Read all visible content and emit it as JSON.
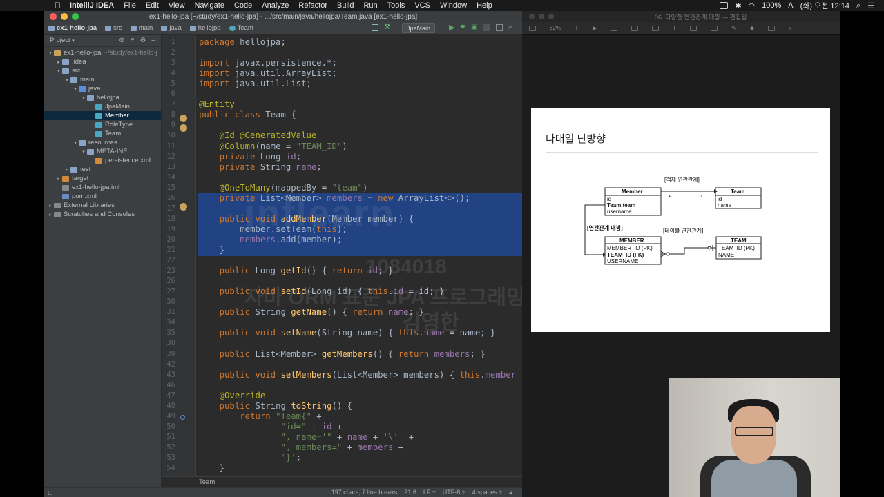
{
  "menubar": {
    "app": "IntelliJ IDEA",
    "items": [
      "File",
      "Edit",
      "View",
      "Navigate",
      "Code",
      "Analyze",
      "Refactor",
      "Build",
      "Run",
      "Tools",
      "VCS",
      "Window",
      "Help"
    ],
    "battery": "100%",
    "clock": "(화) 오전 12:14"
  },
  "ide": {
    "window_title": "ex1-hello-jpa [~/study/ex1-hello-jpa] - .../src/main/java/hellojpa/Team.java [ex1-hello-jpa]",
    "breadcrumbs": [
      "ex1-hello-jpa",
      "src",
      "main",
      "java",
      "hellojpa",
      "Team"
    ],
    "run_config": "JpaMain",
    "project_panel_label": "Project",
    "tree": [
      {
        "label": "ex1-hello-jpa",
        "hint": "~/study/ex1-hello-j",
        "depth": 0,
        "arrow": "▾",
        "color": "#c9a35c"
      },
      {
        "label": ".idea",
        "depth": 1,
        "arrow": "▸",
        "color": "#8aa4c8"
      },
      {
        "label": "src",
        "depth": 1,
        "arrow": "▾",
        "color": "#8aa4c8"
      },
      {
        "label": "main",
        "depth": 2,
        "arrow": "▾",
        "color": "#8aa4c8"
      },
      {
        "label": "java",
        "depth": 3,
        "arrow": "▾",
        "color": "#5a8fd6"
      },
      {
        "label": "hellojpa",
        "depth": 4,
        "arrow": "▾",
        "color": "#8aa4c8"
      },
      {
        "label": "JpaMain",
        "depth": 5,
        "arrow": "",
        "color": "#4aa8c0"
      },
      {
        "label": "Member",
        "depth": 5,
        "arrow": "",
        "color": "#4aa8c0",
        "selected": true
      },
      {
        "label": "RoleType",
        "depth": 5,
        "arrow": "",
        "color": "#4aa8c0"
      },
      {
        "label": "Team",
        "depth": 5,
        "arrow": "",
        "color": "#4aa8c0"
      },
      {
        "label": "resources",
        "depth": 3,
        "arrow": "▾",
        "color": "#8aa4c8"
      },
      {
        "label": "META-INF",
        "depth": 4,
        "arrow": "▾",
        "color": "#8aa4c8"
      },
      {
        "label": "persistence.xml",
        "depth": 5,
        "arrow": "",
        "color": "#d08a3a"
      },
      {
        "label": "test",
        "depth": 2,
        "arrow": "▸",
        "color": "#8aa4c8"
      },
      {
        "label": "target",
        "depth": 1,
        "arrow": "▸",
        "color": "#d08a3a"
      },
      {
        "label": "ex1-hello-jpa.iml",
        "depth": 1,
        "arrow": "",
        "color": "#888"
      },
      {
        "label": "pom.xml",
        "depth": 1,
        "arrow": "",
        "color": "#6a8bc4"
      },
      {
        "label": "External Libraries",
        "depth": 0,
        "arrow": "▸",
        "color": "#888"
      },
      {
        "label": "Scratches and Consoles",
        "depth": 0,
        "arrow": "▸",
        "color": "#888"
      }
    ],
    "editor_footer": "Team",
    "status": {
      "chars": "197 chars, 7 line breaks",
      "pos": "21:6",
      "lf": "LF ÷",
      "enc": "UTF-8 ÷",
      "indent": "4 spaces ÷"
    },
    "watermark": "inflearn",
    "watermark_id": "1084018",
    "watermark_course": "자바 ORM 표준 JPA 프로그래밍 - 기본편",
    "watermark_author": "김영한"
  },
  "code_lines": [
    {
      "n": "1",
      "h": "<span class='k'>package</span> hellojpa;"
    },
    {
      "n": "2",
      "h": ""
    },
    {
      "n": "3",
      "h": "<span class='k'>import</span> javax.persistence.*;"
    },
    {
      "n": "4",
      "h": "<span class='k'>import</span> java.util.ArrayList;"
    },
    {
      "n": "5",
      "h": "<span class='k'>import</span> java.util.List;"
    },
    {
      "n": "6",
      "h": ""
    },
    {
      "n": "7",
      "h": "<span class='a'>@Entity</span>"
    },
    {
      "n": "8",
      "h": "<span class='k'>public class</span> Team {"
    },
    {
      "n": "9",
      "h": ""
    },
    {
      "n": "10",
      "h": "    <span class='a'>@Id @GeneratedValue</span>"
    },
    {
      "n": "11",
      "h": "    <span class='a'>@Column</span>(name = <span class='s'>\"TEAM_ID\"</span>)"
    },
    {
      "n": "12",
      "h": "    <span class='k'>private</span> Long <span class='f'>id</span>;"
    },
    {
      "n": "13",
      "h": "    <span class='k'>private</span> String <span class='f'>name</span>;"
    },
    {
      "n": "14",
      "h": ""
    },
    {
      "n": "15",
      "h": "    <span class='a'>@OneToMany</span>(mappedBy = <span class='s'>\"team\"</span>)"
    },
    {
      "n": "16",
      "h": "    <span class='k'>private</span> List&lt;Member&gt; <span class='f'>members</span> = <span class='k'>new</span> ArrayList&lt;&gt;();"
    },
    {
      "n": "17",
      "h": ""
    },
    {
      "n": "18",
      "h": "    <span class='k'>public void</span> <span class='m'>addMember</span>(Member member) {"
    },
    {
      "n": "19",
      "h": "        member.setTeam(<span class='k'>this</span>);"
    },
    {
      "n": "20",
      "h": "        <span class='f'>members</span>.add(member);"
    },
    {
      "n": "21",
      "h": "    }"
    },
    {
      "n": "22",
      "h": ""
    },
    {
      "n": "23",
      "h": "    <span class='k'>public</span> Long <span class='m'>getId</span>() { <span class='k'>return</span> <span class='f'>id</span>; }"
    },
    {
      "n": "26",
      "h": ""
    },
    {
      "n": "27",
      "h": "    <span class='k'>public void</span> <span class='m'>setId</span>(Long id) { <span class='k'>this</span>.<span class='f'>id</span> = id; }"
    },
    {
      "n": "30",
      "h": ""
    },
    {
      "n": "31",
      "h": "    <span class='k'>public</span> String <span class='m'>getName</span>() { <span class='k'>return</span> <span class='f'>name</span>; }"
    },
    {
      "n": "34",
      "h": ""
    },
    {
      "n": "35",
      "h": "    <span class='k'>public void</span> <span class='m'>setName</span>(String name) { <span class='k'>this</span>.<span class='f'>name</span> = name; }"
    },
    {
      "n": "38",
      "h": ""
    },
    {
      "n": "39",
      "h": "    <span class='k'>public</span> List&lt;Member&gt; <span class='m'>getMembers</span>() { <span class='k'>return</span> <span class='f'>members</span>; }"
    },
    {
      "n": "42",
      "h": ""
    },
    {
      "n": "43",
      "h": "    <span class='k'>public void</span> <span class='m'>setMembers</span>(List&lt;Member&gt; members) { <span class='k'>this</span>.<span class='f'>member</span>"
    },
    {
      "n": "46",
      "h": ""
    },
    {
      "n": "47",
      "h": "    <span class='a'>@Override</span>"
    },
    {
      "n": "48",
      "h": "    <span class='k'>public</span> String <span class='m'>toString</span>() {"
    },
    {
      "n": "49",
      "h": "        <span class='k'>return</span> <span class='s'>\"Team{\"</span> +"
    },
    {
      "n": "50",
      "h": "                <span class='s'>\"id=\"</span> + <span class='f'>id</span> +"
    },
    {
      "n": "51",
      "h": "                <span class='s'>\", name='\"</span> + <span class='f'>name</span> + <span class='s'>'\\''</span> +"
    },
    {
      "n": "52",
      "h": "                <span class='s'>\", members=\"</span> + <span class='f'>members</span> +"
    },
    {
      "n": "53",
      "h": "                <span class='s'>'}'</span>;"
    },
    {
      "n": "54",
      "h": "    }"
    }
  ],
  "keynote": {
    "window_title": "06. 다양한 연관관계 매핑 — 편집됨",
    "zoom": "62%",
    "slide_title": "다대일 단방향",
    "diagram": {
      "obj_label": "[객체 연관관계]",
      "member_title": "Member",
      "member_fields": [
        "id",
        "Team team",
        "username"
      ],
      "team_title": "Team",
      "team_fields": [
        "id",
        "name"
      ],
      "mult_many": "*",
      "mult_one": "1",
      "mapping_label": "[연관관계 매핑]",
      "table_label": "[테이블 연관관계]",
      "MEMBER_title": "MEMBER",
      "MEMBER_fields": [
        "MEMBER_ID (PK)",
        "TEAM_ID (FK)",
        "USERNAME"
      ],
      "TEAM_title": "TEAM",
      "TEAM_fields": [
        "TEAM_ID (PK)",
        "NAME"
      ]
    }
  }
}
